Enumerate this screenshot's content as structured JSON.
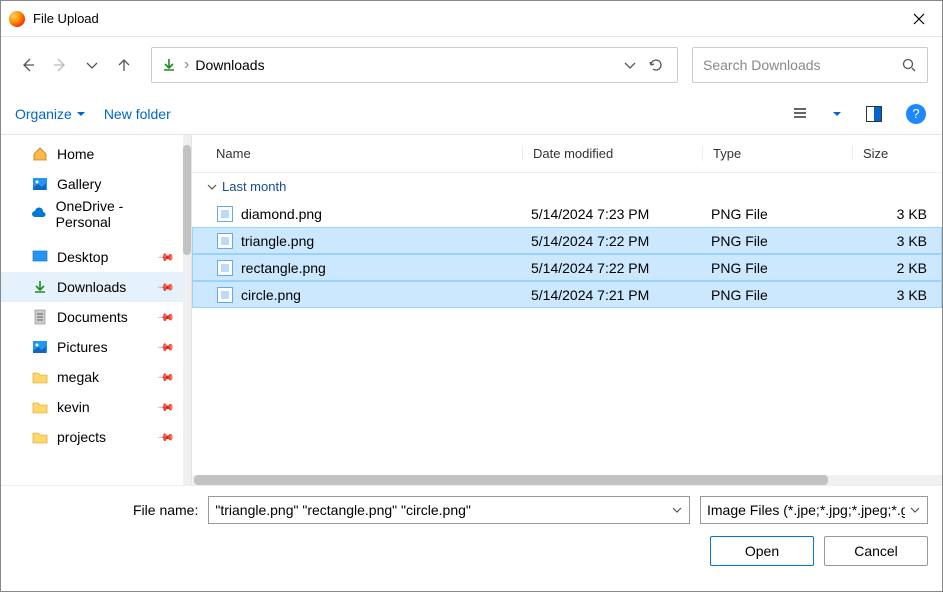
{
  "window": {
    "title": "File Upload"
  },
  "path": {
    "current": "Downloads"
  },
  "search": {
    "placeholder": "Search Downloads"
  },
  "toolbar": {
    "organize": "Organize",
    "newfolder": "New folder"
  },
  "sidebar": {
    "top": [
      {
        "label": "Home",
        "icon": "home"
      },
      {
        "label": "Gallery",
        "icon": "gallery"
      },
      {
        "label": "OneDrive - Personal",
        "icon": "cloud"
      }
    ],
    "quick": [
      {
        "label": "Desktop",
        "icon": "desktop",
        "pinned": true
      },
      {
        "label": "Downloads",
        "icon": "download",
        "pinned": true,
        "active": true
      },
      {
        "label": "Documents",
        "icon": "doc",
        "pinned": true
      },
      {
        "label": "Pictures",
        "icon": "gallery",
        "pinned": true
      },
      {
        "label": "megak",
        "icon": "folder",
        "pinned": true
      },
      {
        "label": "kevin",
        "icon": "folder",
        "pinned": true
      },
      {
        "label": "projects",
        "icon": "folder",
        "pinned": true
      }
    ]
  },
  "columns": {
    "name": "Name",
    "date": "Date modified",
    "type": "Type",
    "size": "Size"
  },
  "group": "Last month",
  "files": [
    {
      "name": "diamond.png",
      "date": "5/14/2024 7:23 PM",
      "type": "PNG File",
      "size": "3 KB",
      "selected": false
    },
    {
      "name": "triangle.png",
      "date": "5/14/2024 7:22 PM",
      "type": "PNG File",
      "size": "3 KB",
      "selected": true
    },
    {
      "name": "rectangle.png",
      "date": "5/14/2024 7:22 PM",
      "type": "PNG File",
      "size": "2 KB",
      "selected": true
    },
    {
      "name": "circle.png",
      "date": "5/14/2024 7:21 PM",
      "type": "PNG File",
      "size": "3 KB",
      "selected": true
    }
  ],
  "footer": {
    "filename_label": "File name:",
    "filename_value": "\"triangle.png\" \"rectangle.png\" \"circle.png\"",
    "filter_value": "Image Files (*.jpe;*.jpg;*.jpeg;*.gif;*.png;*.bmp)",
    "open": "Open",
    "cancel": "Cancel"
  }
}
